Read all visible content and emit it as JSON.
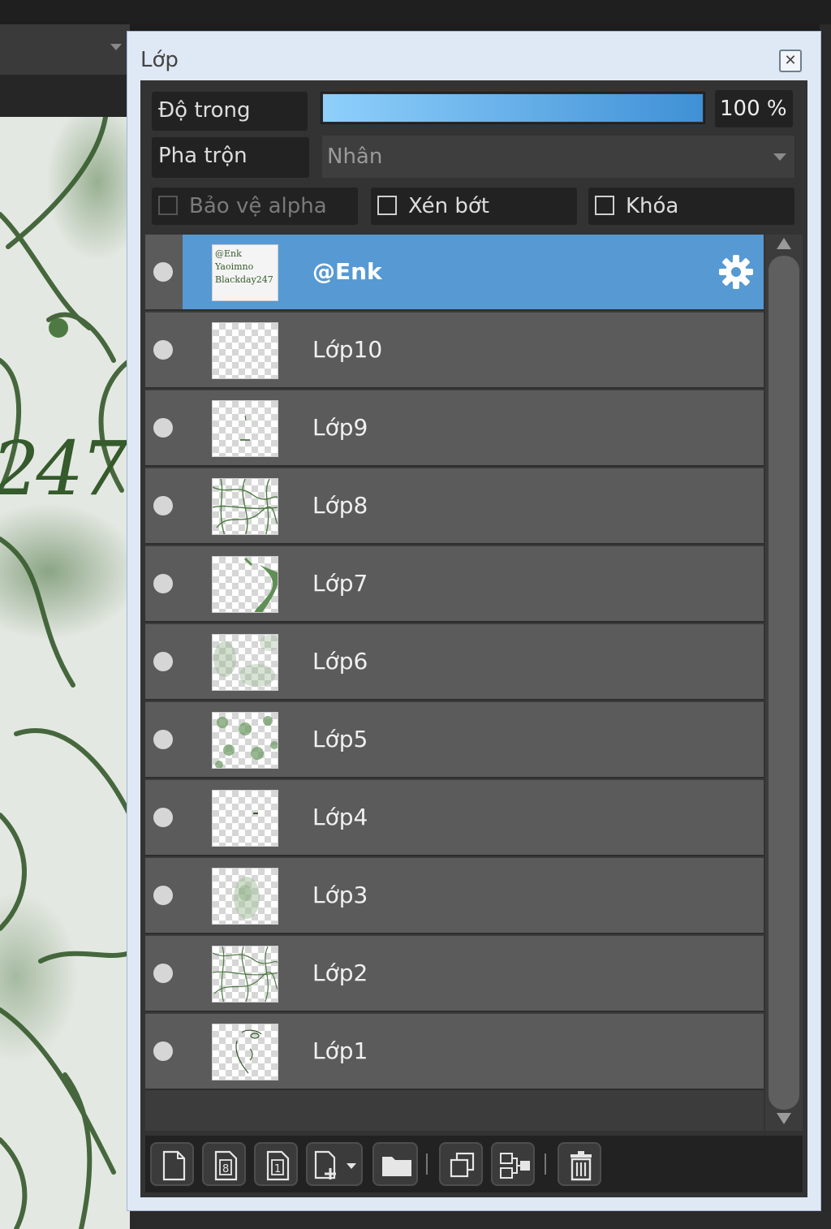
{
  "window": {
    "title": "Lớp",
    "close_icon": "close-icon"
  },
  "properties": {
    "opacity_label": "Độ trong",
    "opacity_percent": 100,
    "opacity_value_text": "100 %",
    "blend_label": "Pha trộn",
    "blend_value": "Nhân",
    "protect_alpha_label": "Bảo vệ alpha",
    "protect_alpha_checked": false,
    "protect_alpha_enabled": false,
    "clipping_label": "Xén bớt",
    "clipping_checked": false,
    "lock_label": "Khóa",
    "lock_checked": false
  },
  "layers": [
    {
      "name": "@Enk",
      "selected": true,
      "visible": true,
      "thumb_text": "@Enk Yaoimno Blackday247"
    },
    {
      "name": "Lớp10",
      "selected": false,
      "visible": true
    },
    {
      "name": "Lớp9",
      "selected": false,
      "visible": true
    },
    {
      "name": "Lớp8",
      "selected": false,
      "visible": true
    },
    {
      "name": "Lớp7",
      "selected": false,
      "visible": true
    },
    {
      "name": "Lớp6",
      "selected": false,
      "visible": true
    },
    {
      "name": "Lớp5",
      "selected": false,
      "visible": true
    },
    {
      "name": "Lớp4",
      "selected": false,
      "visible": true
    },
    {
      "name": "Lớp3",
      "selected": false,
      "visible": true
    },
    {
      "name": "Lớp2",
      "selected": false,
      "visible": true
    },
    {
      "name": "Lớp1",
      "selected": false,
      "visible": true
    }
  ],
  "toolbar": {
    "buttons": [
      {
        "name": "new-layer-button",
        "icon": "new-page-icon"
      },
      {
        "name": "new-8bit-layer-button",
        "icon": "page-8-icon"
      },
      {
        "name": "new-1bit-layer-button",
        "icon": "page-1-icon"
      },
      {
        "name": "add-layer-menu-button",
        "icon": "page-add-dropdown-icon"
      },
      {
        "name": "new-folder-button",
        "icon": "folder-icon"
      },
      {
        "name": "duplicate-layer-button",
        "icon": "duplicate-icon"
      },
      {
        "name": "merge-down-button",
        "icon": "merge-icon"
      },
      {
        "name": "delete-layer-button",
        "icon": "trash-icon"
      }
    ]
  },
  "canvas": {
    "visible_text": "247"
  },
  "colors": {
    "selected_row": "#5699d3",
    "row": "#5b5b5b",
    "accent_fill": "#8fd0fb",
    "line_art": "#355a2c"
  }
}
